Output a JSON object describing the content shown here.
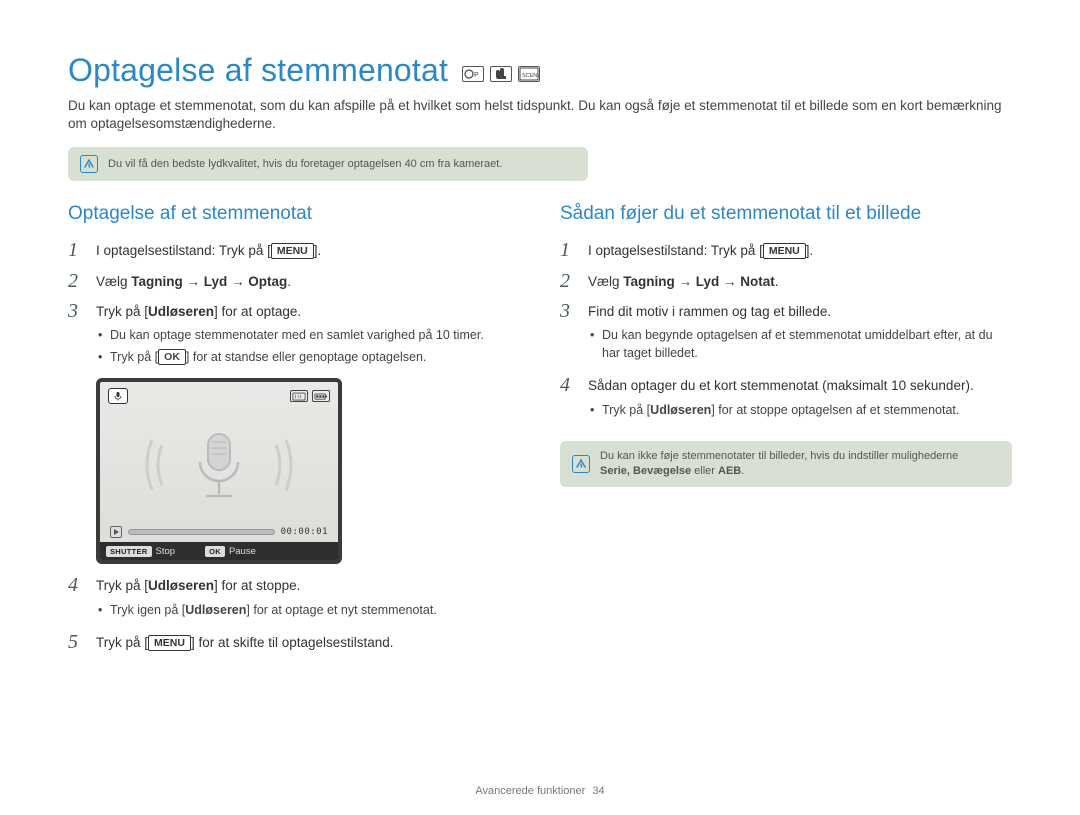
{
  "page": {
    "title": "Optagelse af stemmenotat",
    "mode_icons": [
      "P",
      "hand",
      "SCENE"
    ],
    "intro": "Du kan optage et stemmenotat, som du kan afspille på et hvilket som helst tidspunkt. Du kan også føje et stemmenotat til et billede som en kort bemærkning om optagelsesomstændighederne.",
    "top_note": "Du vil få den bedste lydkvalitet, hvis du foretager optagelsen 40 cm fra kameraet."
  },
  "left": {
    "heading": "Optagelse af et stemmenotat",
    "steps": {
      "s1": {
        "pre": "I optagelsestilstand: Tryk på [",
        "key": "MENU",
        "post": "]."
      },
      "s2": {
        "pre": "Vælg ",
        "bold": "Tagning → Lyd → Optag",
        "post": "."
      },
      "s3": {
        "text": "Tryk på [Udløseren] for at optage.",
        "bold_word": "Udløseren",
        "bullets": {
          "b1": "Du kan optage stemmenotater med en samlet varighed på 10 timer.",
          "b2_pre": "Tryk på [",
          "b2_key": "OK",
          "b2_post": "] for at standse eller genoptage optagelsen."
        }
      },
      "s4": {
        "text_pre": "Tryk på [",
        "bold_word": "Udløseren",
        "text_post": "] for at stoppe.",
        "bullet_pre": "Tryk igen på [",
        "bullet_bold": "Udløseren",
        "bullet_post": "] for at optage et nyt stemmenotat."
      },
      "s5": {
        "pre": "Tryk på [",
        "key": "MENU",
        "post": "] for at skifte til optagelsestilstand."
      }
    },
    "screen": {
      "timer": "00:00:01",
      "shutter_label": "SHUTTER",
      "shutter_text": "Stop",
      "ok_label": "OK",
      "ok_text": "Pause",
      "badge1": "",
      "badge2": ""
    }
  },
  "right": {
    "heading": "Sådan føjer du et stemmenotat til et billede",
    "steps": {
      "s1": {
        "pre": "I optagelsestilstand: Tryk på [",
        "key": "MENU",
        "post": "]."
      },
      "s2": {
        "pre": "Vælg ",
        "bold": "Tagning → Lyd → Notat",
        "post": "."
      },
      "s3": {
        "text": "Find dit motiv i rammen og tag et billede.",
        "bullet": "Du kan begynde optagelsen af et stemmenotat umiddelbart efter, at du har taget billedet."
      },
      "s4": {
        "text": "Sådan optager du et kort stemmenotat (maksimalt 10 sekunder).",
        "bullet_pre": "Tryk på [",
        "bullet_bold": "Udløseren",
        "bullet_post": "] for at stoppe optagelsen af et stemmenotat."
      }
    },
    "note": {
      "line1": "Du kan ikke føje stemmenotater til billeder, hvis du indstiller mulighederne",
      "line2_pre": "",
      "line2_bold": "Serie, Bevægelse",
      "line2_mid": " eller ",
      "line2_bold2": "AEB",
      "line2_post": "."
    }
  },
  "footer": {
    "section": "Avancerede funktioner",
    "page_number": "34"
  }
}
